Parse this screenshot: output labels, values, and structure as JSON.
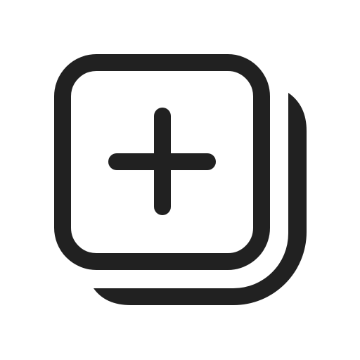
{
  "icon": {
    "name": "add-square-multiple-icon",
    "color": "#212121",
    "background": "#ffffff"
  }
}
